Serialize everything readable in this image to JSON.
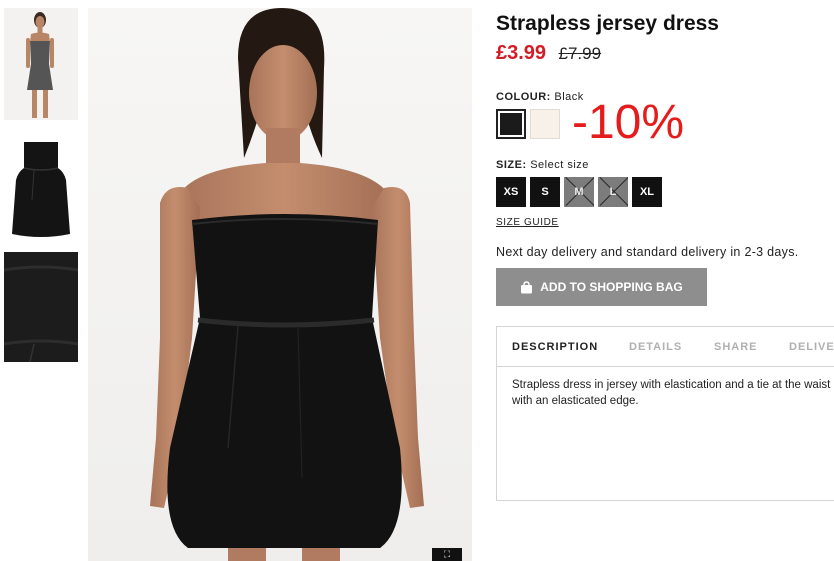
{
  "product": {
    "title": "Strapless jersey dress",
    "price_now": "£3.99",
    "price_old": "£7.99"
  },
  "colour": {
    "label": "COLOUR:",
    "value": "Black",
    "swatches": [
      "#1b1b1b",
      "#f7f1ea"
    ],
    "promo": "-10%"
  },
  "size": {
    "label": "SIZE:",
    "value": "Select size",
    "options": [
      {
        "label": "XS",
        "available": true
      },
      {
        "label": "S",
        "available": true
      },
      {
        "label": "M",
        "available": false
      },
      {
        "label": "L",
        "available": false
      },
      {
        "label": "XL",
        "available": true
      }
    ],
    "guide": "SIZE GUIDE"
  },
  "delivery_note": "Next day delivery and standard delivery in 2-3 days.",
  "add_to_bag": "ADD TO SHOPPING BAG",
  "tabs": {
    "items": [
      "DESCRIPTION",
      "DETAILS",
      "SHARE",
      "DELIVERY"
    ],
    "active": "DESCRIPTION"
  },
  "description": {
    "line1": "Strapless dress in jersey with elastication and a tie at the waist",
    "line2": "with an elasticated edge."
  },
  "zoom_icon": "expand-icon",
  "colors": {
    "sale_red": "#d21d26",
    "promo_red": "#e61b1b",
    "button_grey": "#8e8e8e"
  }
}
